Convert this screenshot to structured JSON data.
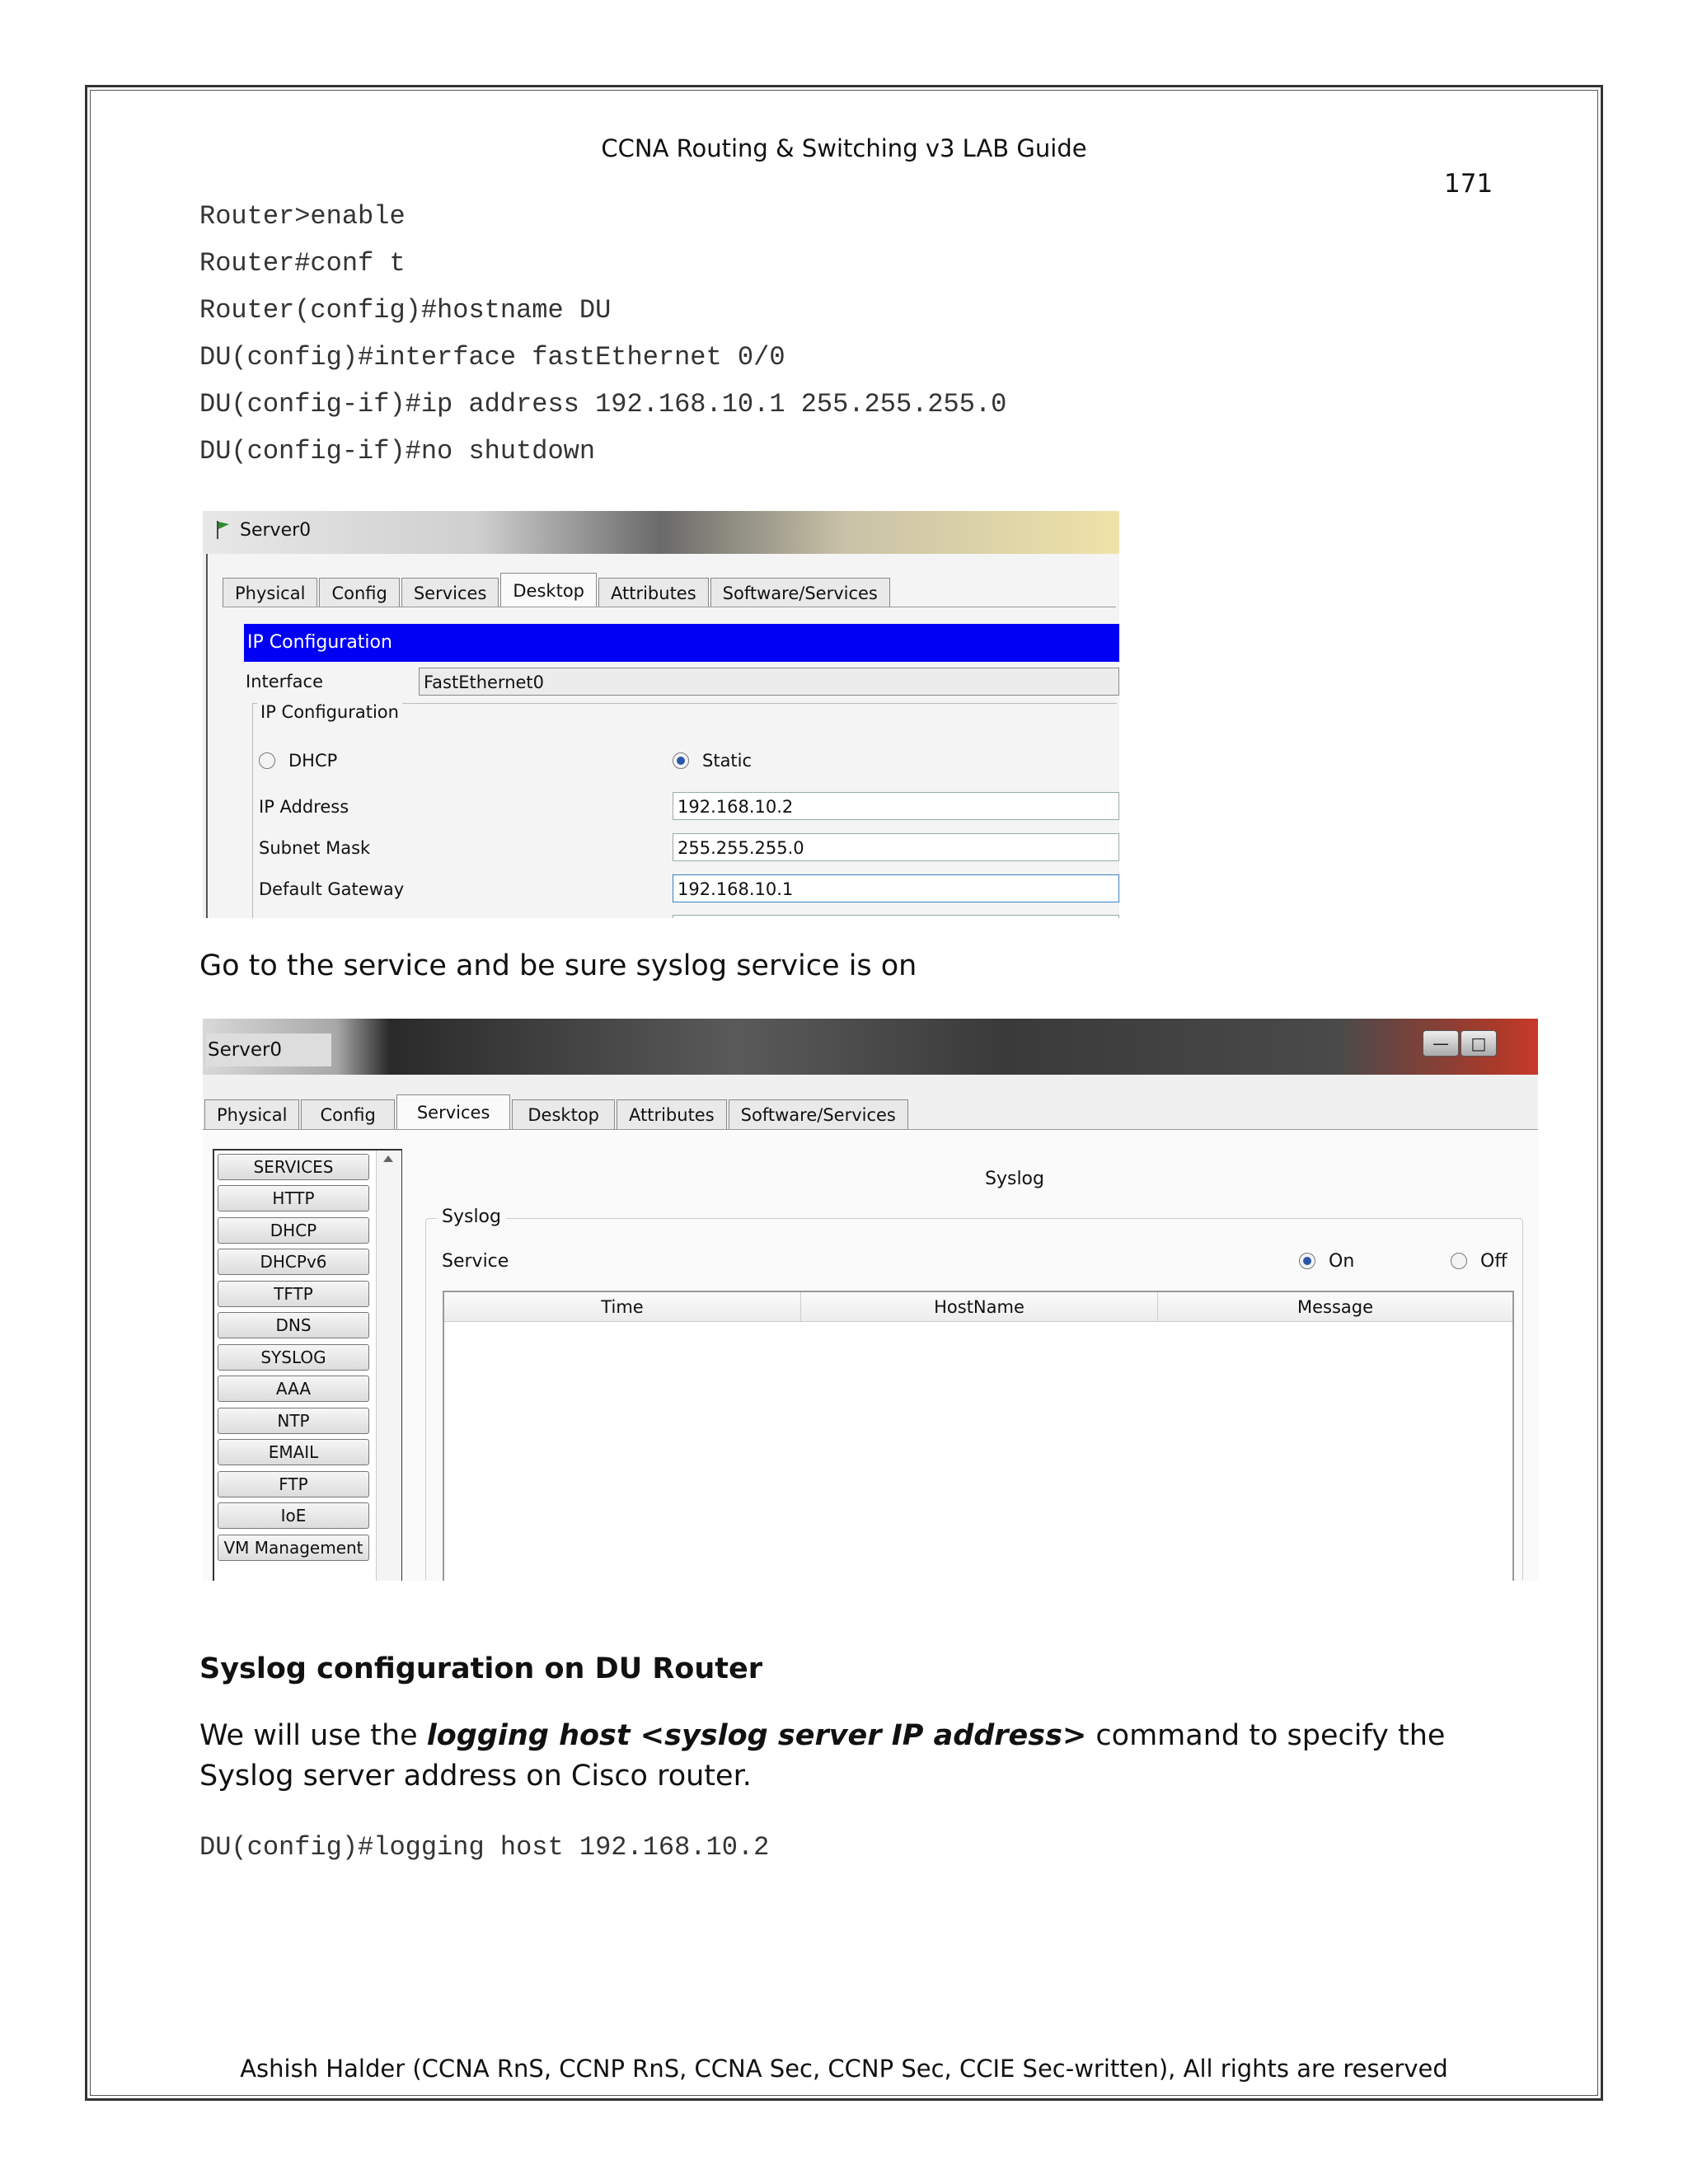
{
  "header": {
    "title": "CCNA Routing & Switching v3 LAB Guide",
    "page_number": "171"
  },
  "commands_top": [
    "Router>enable",
    "Router#conf t",
    "Router(config)#hostname DU",
    "DU(config)#interface fastEthernet 0/0",
    "DU(config-if)#ip address 192.168.10.1 255.255.255.0",
    "DU(config-if)#no shutdown"
  ],
  "screenshot1": {
    "window_title": "Server0",
    "tabs": [
      "Physical",
      "Config",
      "Services",
      "Desktop",
      "Attributes",
      "Software/Services"
    ],
    "active_tab": "Desktop",
    "section_bar": "IP Configuration",
    "interface_label": "Interface",
    "interface_value": "FastEthernet0",
    "group_title": "IP Configuration",
    "dhcp_label": "DHCP",
    "static_label": "Static",
    "selected_mode": "Static",
    "ip_label": "IP Address",
    "ip_value": "192.168.10.2",
    "mask_label": "Subnet Mask",
    "mask_value": "255.255.255.0",
    "gateway_label": "Default Gateway",
    "gateway_value": "192.168.10.1"
  },
  "instruction": "Go to the service and be sure syslog service is on",
  "screenshot2": {
    "window_title": "Server0",
    "tabs": [
      "Physical",
      "Config",
      "Services",
      "Desktop",
      "Attributes",
      "Software/Services"
    ],
    "active_tab": "Services",
    "services": [
      "SERVICES",
      "HTTP",
      "DHCP",
      "DHCPv6",
      "TFTP",
      "DNS",
      "SYSLOG",
      "AAA",
      "NTP",
      "EMAIL",
      "FTP",
      "IoE",
      "VM Management"
    ],
    "panel_title": "Syslog",
    "group_title": "Syslog",
    "service_label": "Service",
    "on_label": "On",
    "off_label": "Off",
    "service_state": "On",
    "table_headers": [
      "Time",
      "HostName",
      "Message"
    ]
  },
  "section_heading": "Syslog configuration on DU Router",
  "paragraph": {
    "pre": "We will use the ",
    "emphasis": "logging host <syslog server IP address>",
    "post": " command to specify the Syslog server address on Cisco router."
  },
  "command_bottom": "DU(config)#logging host 192.168.10.2",
  "footer": "Ashish Halder (CCNA RnS, CCNP RnS, CCNA Sec, CCNP Sec, CCIE Sec-written), All rights are reserved"
}
